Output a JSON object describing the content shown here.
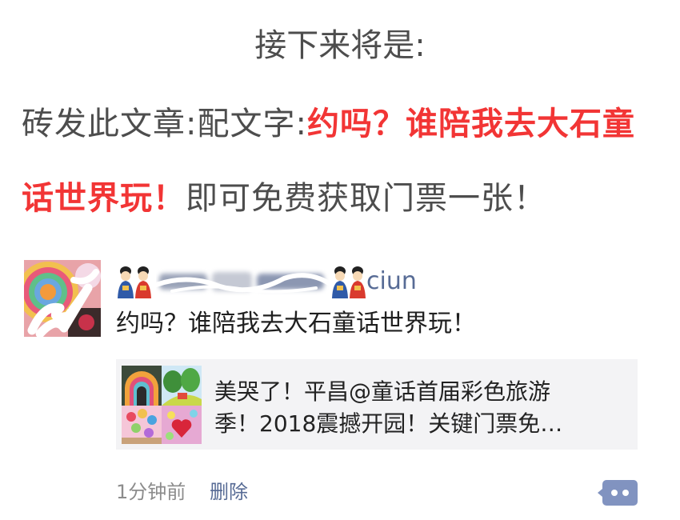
{
  "header": {
    "title": "接下来将是:"
  },
  "instructions": {
    "line1_prefix": "砖发此文章:配文字:",
    "line1_highlight": "约吗？谁陪我去大石童",
    "line2_highlight": "话世界玩！",
    "line2_suffix": "即可免费获取门票一张！"
  },
  "post": {
    "avatar_icon": "avatar-image",
    "author_icon": "dolls-emoji-icon",
    "author_visible": "ciun",
    "text": "约吗？谁陪我去大石童话世界玩！",
    "link": {
      "thumbnail_icon": "colorful-park-thumbnail",
      "title_lines": [
        "美哭了！平昌@童话首届彩色旅游",
        "季！2018震撼开园！关键门票免…"
      ]
    },
    "time": "1分钟前",
    "delete_label": "删除",
    "comment_icon": "comment-dots-icon"
  },
  "colors": {
    "text_gray": "#4d4d4d",
    "highlight_red": "#f23535",
    "link_blue": "#576b95",
    "card_bg": "#f3f3f5",
    "comment_button": "#8193c0"
  }
}
